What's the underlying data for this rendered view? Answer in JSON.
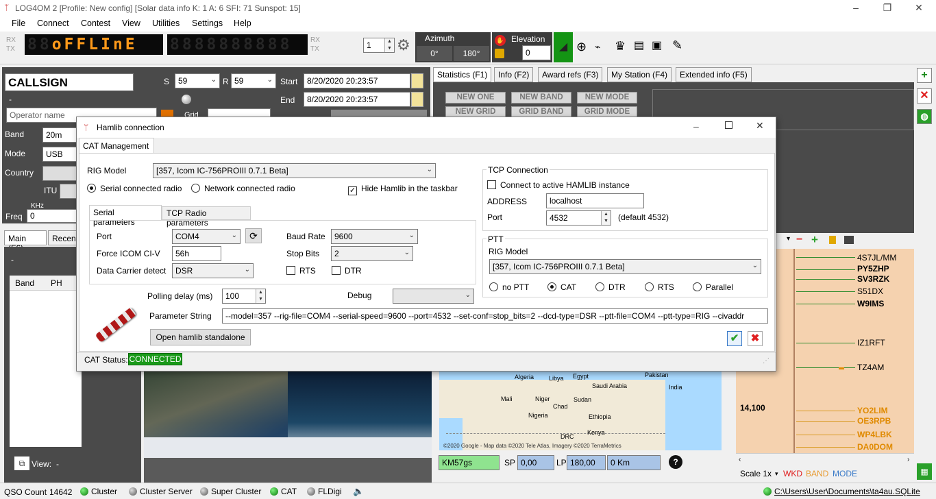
{
  "window": {
    "title": "LOG4OM 2 [Profile: New config] [Solar data info K: 1 A: 6 SFI: 71 Sunspot: 15]"
  },
  "menu": [
    "File",
    "Connect",
    "Contest",
    "View",
    "Utilities",
    "Settings",
    "Help"
  ],
  "toolbar": {
    "rx": "RX",
    "tx": "TX",
    "display_dim": "88",
    "display_text": "oFFLInE",
    "display_dim2": "8888888888",
    "vfo_value": "1",
    "azimuth_label": "Azimuth",
    "azimuth_short": "0°",
    "azimuth_long": "180°",
    "elevation_label": "Elevation",
    "elevation_value": "0"
  },
  "qso": {
    "callsign": "CALLSIGN",
    "dash": "-",
    "operator_placeholder": "Operator name",
    "s_label": "S",
    "s_value": "59",
    "r_label": "R",
    "r_value": "59",
    "start_label": "Start",
    "start_value": "8/20/2020 20:23:57",
    "end_label": "End",
    "end_value": "8/20/2020 20:23:57",
    "grid_label": "Grid",
    "band_label": "Band",
    "band_value": "20m",
    "mode_label": "Mode",
    "mode_value": "USB",
    "country_label": "Country",
    "itu_label": "ITU",
    "khz_label": "KHz",
    "freq_label": "Freq",
    "freq_value": "0",
    "tab_main": "Main (F6)",
    "tab_recent": "Recen",
    "list_dash": "-",
    "col_band": "Band",
    "col_ph": "PH",
    "view_label": "View:",
    "view_value": "-"
  },
  "stats": {
    "tabs": [
      "Statistics (F1)",
      "Info (F2)",
      "Award refs (F3)",
      "My Station (F4)",
      "Extended info (F5)"
    ],
    "buttons": [
      "NEW ONE",
      "NEW BAND",
      "NEW MODE",
      "NEW GRID",
      "GRID BAND",
      "GRID MODE"
    ]
  },
  "map": {
    "labels": [
      "Algeria",
      "Libya",
      "Egypt",
      "Pakistan",
      "Saudi Arabia",
      "India",
      "Mali",
      "Niger",
      "Chad",
      "Sudan",
      "Nigeria",
      "Ethiopia",
      "DRC",
      "Kenya"
    ],
    "credit": "©2020 Google - Map data ©2020 Tele Atlas, Imagery ©2020 TerraMetrics",
    "locator": "KM57gs",
    "sp_label": "SP",
    "sp_value": "0,00",
    "lp_label": "LP",
    "lp_value": "180,00",
    "distance": "0 Km",
    "help": "?"
  },
  "bandmap": {
    "frequency": "14,100",
    "calls": [
      {
        "call": "4S7JL/MM",
        "color": "#000000",
        "bold": false
      },
      {
        "call": "PY5ZHP",
        "color": "#000000",
        "bold": true
      },
      {
        "call": "SV3RZK",
        "color": "#000000",
        "bold": true
      },
      {
        "call": "S51DX",
        "color": "#000000",
        "bold": false
      },
      {
        "call": "W9IMS",
        "color": "#000000",
        "bold": true
      },
      {
        "call": "IZ1RFT",
        "color": "#000000",
        "bold": false
      },
      {
        "call": "TZ4AM",
        "color": "#000000",
        "bold": false
      },
      {
        "call": "YO2LIM",
        "color": "#e08a00",
        "bold": true
      },
      {
        "call": "OE3RPB",
        "color": "#e08a00",
        "bold": true
      },
      {
        "call": "WP4LBK",
        "color": "#e08a00",
        "bold": true
      },
      {
        "call": "DA0DOM",
        "color": "#e08a00",
        "bold": true
      }
    ],
    "scale": "Scale 1x",
    "wkd": "WKD",
    "band": "BAND",
    "mode": "MODE"
  },
  "statusbar": {
    "qso_count_label": "QSO Count",
    "qso_count_value": "14642",
    "cluster": "Cluster",
    "cluster_server": "Cluster Server",
    "super_cluster": "Super Cluster",
    "cat": "CAT",
    "fldigi": "FLDigi",
    "db_path": "C:\\Users\\User\\Documents\\ta4au.SQLite"
  },
  "dialog": {
    "title": "Hamlib connection",
    "tab": "CAT Management",
    "rig_model_label": "RIG Model",
    "rig_model_value": "[357, Icom IC-756PROIII 0.7.1 Beta]",
    "serial_radio": "Serial connected radio",
    "network_radio": "Network connected radio",
    "hide_hamlib": "Hide Hamlib in the taskbar",
    "subtab_serial": "Serial parameters",
    "subtab_tcp": "TCP Radio parameters",
    "port_label": "Port",
    "port_value": "COM4",
    "force_label": "Force ICOM CI-V",
    "force_value": "56h",
    "dcd_label": "Data Carrier detect",
    "dcd_value": "DSR",
    "baud_label": "Baud Rate",
    "baud_value": "9600",
    "stop_label": "Stop Bits",
    "stop_value": "2",
    "rts": "RTS",
    "dtr": "DTR",
    "polling_label": "Polling delay (ms)",
    "polling_value": "100",
    "debug_label": "Debug",
    "param_label": "Parameter String",
    "param_value": "--model=357 --rig-file=COM4 --serial-speed=9600 --port=4532 --set-conf=stop_bits=2 --dcd-type=DSR --ptt-file=COM4 --ptt-type=RIG --civaddr",
    "open_standalone": "Open hamlib standalone",
    "tcp_title": "TCP Connection",
    "connect_active": "Connect to active HAMLIB instance",
    "address_label": "ADDRESS",
    "address_value": "localhost",
    "tcp_port_label": "Port",
    "tcp_port_value": "4532",
    "tcp_port_default": "(default 4532)",
    "ptt_title": "PTT",
    "ptt_rig_label": "RIG Model",
    "ptt_rig_value": "[357, Icom IC-756PROIII 0.7.1 Beta]",
    "ptt_options": [
      "no PTT",
      "CAT",
      "DTR",
      "RTS",
      "Parallel"
    ],
    "cat_status_label": "CAT Status:",
    "cat_status_value": "CONNECTED",
    "connected_color": "#1a9a1a"
  }
}
